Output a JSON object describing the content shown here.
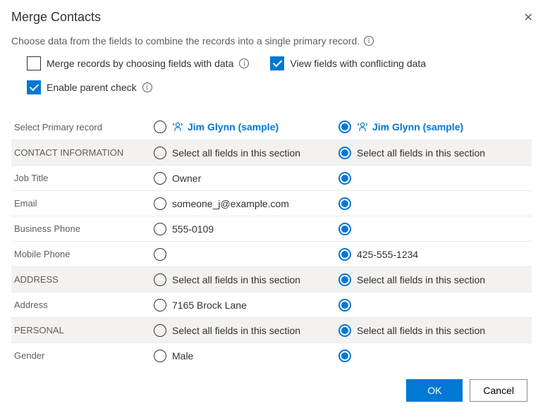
{
  "dialog": {
    "title": "Merge Contacts",
    "description": "Choose data from the fields to combine the records into a single primary record."
  },
  "options": {
    "merge_by_fields": {
      "label": "Merge records by choosing fields with data",
      "checked": false
    },
    "view_conflicting": {
      "label": "View fields with conflicting data",
      "checked": true
    },
    "enable_parent": {
      "label": "Enable parent check",
      "checked": true
    }
  },
  "primary_label": "Select Primary record",
  "records": {
    "left": {
      "name": "Jim Glynn (sample)",
      "selected": false
    },
    "right": {
      "name": "Jim Glynn (sample)",
      "selected": true
    }
  },
  "section_select_all": "Select all fields in this section",
  "rows": [
    {
      "type": "section",
      "label": "CONTACT INFORMATION"
    },
    {
      "type": "field",
      "label": "Job Title",
      "left": "Owner",
      "right": ""
    },
    {
      "type": "field",
      "label": "Email",
      "left": "someone_j@example.com",
      "right": ""
    },
    {
      "type": "field",
      "label": "Business Phone",
      "left": "555-0109",
      "right": ""
    },
    {
      "type": "field",
      "label": "Mobile Phone",
      "left": "",
      "right": "425-555-1234"
    },
    {
      "type": "section",
      "label": "ADDRESS"
    },
    {
      "type": "field",
      "label": "Address",
      "left": "7165 Brock Lane",
      "right": ""
    },
    {
      "type": "section",
      "label": "PERSONAL"
    },
    {
      "type": "field",
      "label": "Gender",
      "left": "Male",
      "right": ""
    }
  ],
  "buttons": {
    "ok": "OK",
    "cancel": "Cancel"
  }
}
